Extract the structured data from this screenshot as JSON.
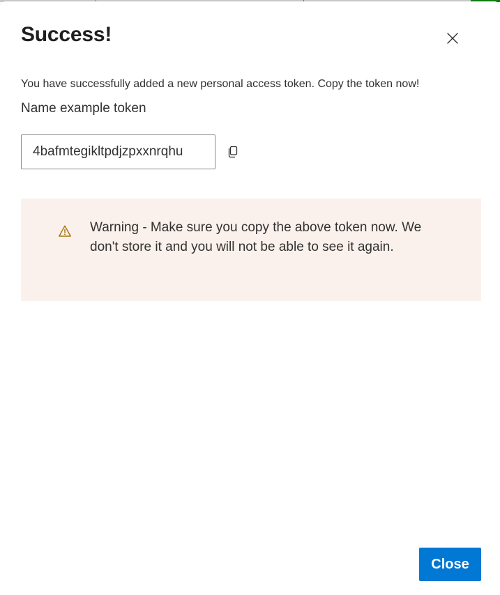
{
  "dialog": {
    "title": "Success!",
    "message": "You have successfully added a new personal access token. Copy the token now!",
    "name_line": "Name example token",
    "token_value": "4bafmtegikltpdjzpxxnrqhu",
    "warning_text": "Warning - Make sure you copy the above token now. We don't store it and you will not be able to see it again.",
    "close_button_label": "Close"
  },
  "colors": {
    "primary": "#0078d4",
    "warning_background": "#fbf1ec",
    "warning_icon": "#a4720c",
    "text": "#323130"
  },
  "icons": {
    "dismiss": "close-icon",
    "copy": "copy-icon",
    "warning": "warning-icon"
  }
}
